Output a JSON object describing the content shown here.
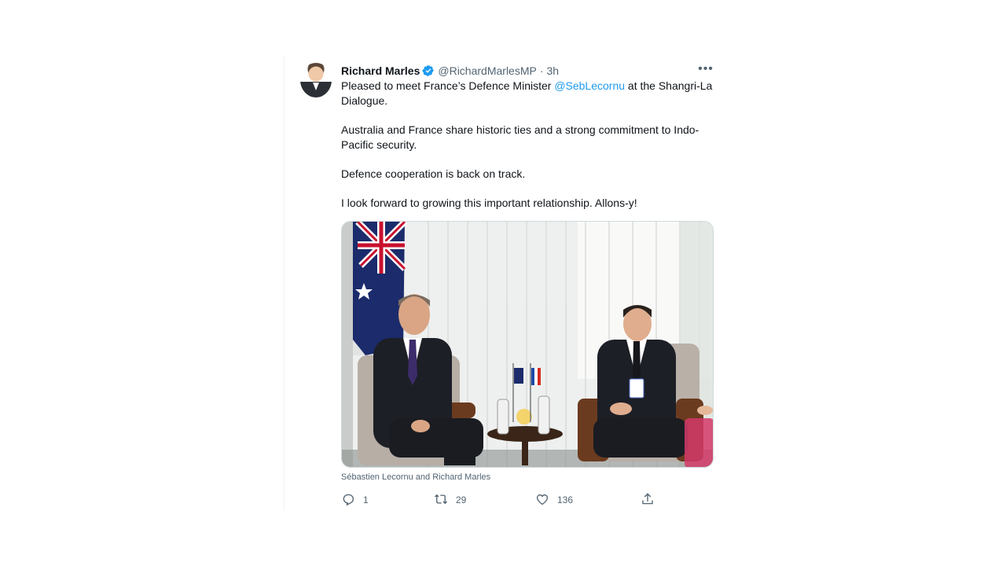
{
  "tweet": {
    "display_name": "Richard Marles",
    "handle": "@RichardMarlesMP",
    "separator": "·",
    "time": "3h",
    "more_label": "•••",
    "text_part1": "Pleased to meet France’s Defence Minister ",
    "mention": "@SebLecornu",
    "text_part2": " at the Shangri-La Dialogue.",
    "paragraph2": "Australia and France share historic ties and a strong commitment to Indo-Pacific security.",
    "paragraph3": "Defence cooperation is back on track.",
    "paragraph4": "I look forward to growing this important relationship. Allons-y!",
    "media_caption": "Sébastien Lecornu and Richard Marles",
    "actions": {
      "reply_count": "1",
      "retweet_count": "29",
      "like_count": "136"
    }
  },
  "colors": {
    "accent": "#1d9bf0",
    "secondary_text": "#536471",
    "primary_text": "#0f1419"
  },
  "icons": {
    "verified": "verified-badge-icon",
    "more": "more-horizontal-icon",
    "reply": "reply-icon",
    "retweet": "retweet-icon",
    "like": "like-icon",
    "share": "share-icon"
  }
}
